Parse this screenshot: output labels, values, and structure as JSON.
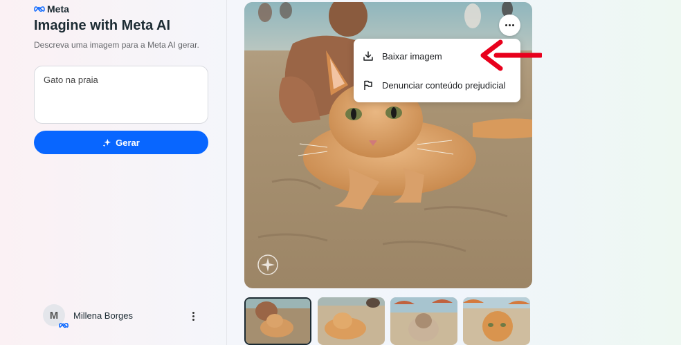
{
  "brand": {
    "logo_text": "Meta"
  },
  "sidebar": {
    "title": "Imagine with Meta AI",
    "subtitle": "Descreva uma imagem para a Meta AI gerar.",
    "prompt_value": "Gato na praia",
    "generate_label": "Gerar"
  },
  "user": {
    "initial": "M",
    "name": "Millena Borges"
  },
  "image_menu": {
    "items": [
      {
        "label": "Baixar imagem",
        "icon": "download-icon"
      },
      {
        "label": "Denunciar conteúdo prejudicial",
        "icon": "flag-icon"
      }
    ]
  },
  "thumbnails": {
    "count": 4,
    "selected_index": 0
  },
  "colors": {
    "accent": "#0866ff",
    "annotation_arrow": "#e8001c"
  }
}
